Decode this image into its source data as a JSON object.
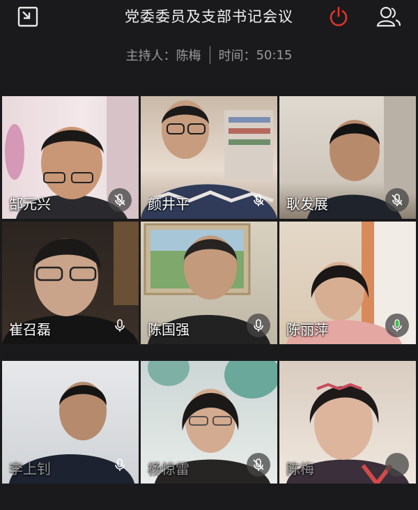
{
  "header": {
    "title": "党委委员及支部书记会议",
    "host_label": "主持人：",
    "host_name": "陈梅",
    "time_label": "时间：",
    "time_value": "50:15"
  },
  "icons": {
    "minimize": "minimize-window-icon",
    "power": "power-icon",
    "participants": "participants-icon"
  },
  "colors": {
    "power": "#e0352b",
    "mic_active": "#3fbf4a",
    "background": "#1a1a1c"
  },
  "participants": [
    {
      "name": "郜元兴",
      "mic": "muted"
    },
    {
      "name": "颜井平",
      "mic": "muted"
    },
    {
      "name": "耿发展",
      "mic": "muted"
    },
    {
      "name": "崔召磊",
      "mic": "on"
    },
    {
      "name": "陈国强",
      "mic": "on"
    },
    {
      "name": "陈丽萍",
      "mic": "speaking"
    },
    {
      "name": "李上钊",
      "mic": "on"
    },
    {
      "name": "杨惊雷",
      "mic": "muted"
    },
    {
      "name": "陈梅",
      "mic": "off"
    }
  ]
}
